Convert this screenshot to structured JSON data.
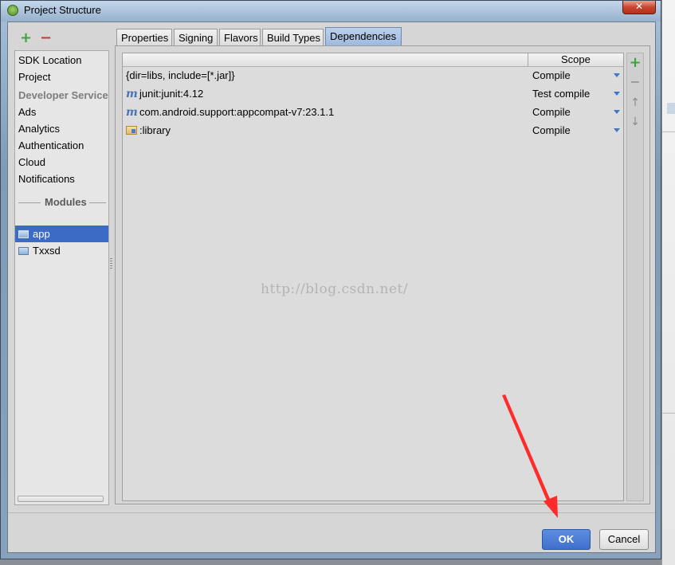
{
  "window": {
    "title": "Project Structure",
    "close_glyph": "✕"
  },
  "left_panel": {
    "add_glyph": "+",
    "remove_glyph": "−",
    "items": [
      {
        "label": "SDK Location",
        "kind": "item"
      },
      {
        "label": "Project",
        "kind": "item"
      },
      {
        "label": "Developer Services",
        "kind": "header"
      },
      {
        "label": "Ads",
        "kind": "item"
      },
      {
        "label": "Analytics",
        "kind": "item"
      },
      {
        "label": "Authentication",
        "kind": "item"
      },
      {
        "label": "Cloud",
        "kind": "item"
      },
      {
        "label": "Notifications",
        "kind": "item"
      }
    ],
    "modules_label": "Modules",
    "modules": [
      {
        "label": "app",
        "selected": true,
        "icon": "module-folder-icon"
      },
      {
        "label": "Txxsd",
        "selected": false,
        "icon": "module-folder-icon"
      }
    ]
  },
  "tabs": [
    {
      "label": "Properties",
      "active": false
    },
    {
      "label": "Signing",
      "active": false
    },
    {
      "label": "Flavors",
      "active": false
    },
    {
      "label": "Build Types",
      "active": false
    },
    {
      "label": "Dependencies",
      "active": true
    }
  ],
  "dependencies": {
    "scope_header": "Scope",
    "rows": [
      {
        "name": "{dir=libs, include=[*.jar]}",
        "icon": "none",
        "scope": "Compile"
      },
      {
        "name": "junit:junit:4.12",
        "icon": "maven-icon",
        "scope": "Test compile"
      },
      {
        "name": "com.android.support:appcompat-v7:23.1.1",
        "icon": "maven-icon",
        "scope": "Compile"
      },
      {
        "name": ":library",
        "icon": "module-folder-icon",
        "scope": "Compile"
      }
    ],
    "tools": {
      "add": "+",
      "remove": "−",
      "up": "↑",
      "down": "↓"
    }
  },
  "watermark": "http://blog.csdn.net/",
  "buttons": {
    "ok": "OK",
    "cancel": "Cancel"
  },
  "colors": {
    "selection": "#3b6bc4",
    "ok_button": "#4a7bd6",
    "annotation_arrow": "#ff2a2a"
  }
}
